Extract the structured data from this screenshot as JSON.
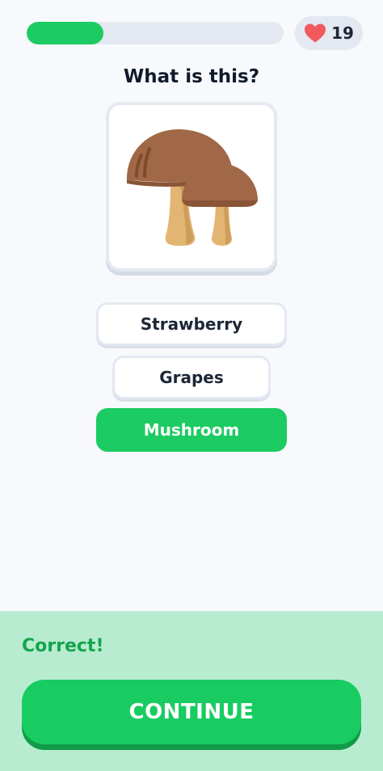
{
  "header": {
    "progress_fraction": 0.3,
    "lives": "19",
    "lives_icon": "heart-icon"
  },
  "question": {
    "text": "What is this?",
    "image_icon": "mushroom-icon"
  },
  "options": [
    {
      "label": "Strawberry",
      "selected": false
    },
    {
      "label": "Grapes",
      "selected": false
    },
    {
      "label": "Mushroom",
      "selected": true
    }
  ],
  "feedback": {
    "message": "Correct!",
    "continue_label": "CONTINUE"
  },
  "colors": {
    "accent_green": "#1ccb62",
    "heart_red": "#f05a5f",
    "feedback_bg": "#b8ecd0",
    "mushroom_cap": "#a06846",
    "mushroom_stem": "#e3b572"
  }
}
